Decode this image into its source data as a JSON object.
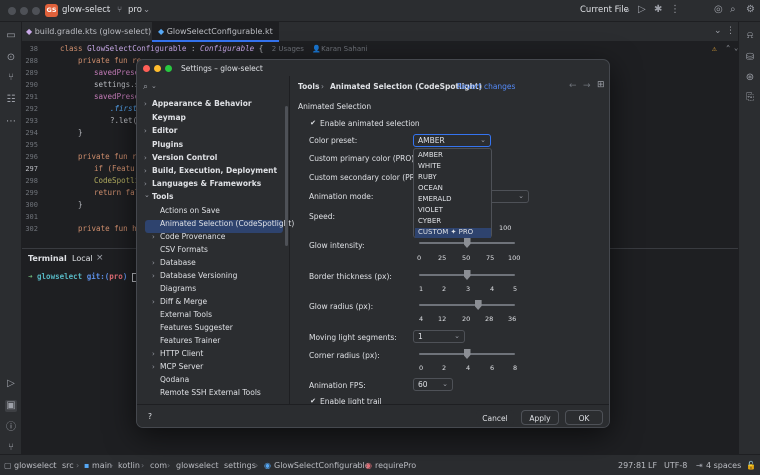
{
  "topbar": {
    "project_badge": "GS",
    "project_name": "glow-select",
    "branch": "pro",
    "run_config": "Current File"
  },
  "tabs": [
    {
      "label": "build.gradle.kts (glow-select)"
    },
    {
      "label": "GlowSelectConfigurable.kt"
    }
  ],
  "editor": {
    "line_numbers": [
      "38",
      "288",
      "289",
      "290",
      "291",
      "292",
      "293",
      "294",
      "295",
      "296",
      "297",
      "298",
      "299",
      "300",
      "301",
      "302",
      "303"
    ],
    "class_line": {
      "kw": "class",
      "name": "GlowSelectConfigurable",
      "colon": ":",
      "super": "Configurable",
      "brace": "{",
      "usages": "2 Usages",
      "author": "Karan Sahani"
    },
    "lines": [
      "private fun re",
      "savedPrese",
      "settings.s",
      "savedPrese",
      ".first",
      "?.let(",
      "}",
      "private fun re",
      "if (Featu",
      "CodeSpotli",
      "return fals",
      "}",
      "private fun ha"
    ]
  },
  "terminal": {
    "tab_terminal": "Terminal",
    "tab_local": "Local",
    "prompt_dir": "glowselect",
    "prompt_git": "git:(",
    "prompt_branch": "pro",
    "prompt_end": ")"
  },
  "dialog": {
    "title": "Settings – glow-select",
    "search_placeholder": "",
    "breadcrumb_parent": "Tools",
    "breadcrumb_sep": "›",
    "breadcrumb_current": "Animated Selection (CodeSpotlight)",
    "revert": "Revert changes",
    "tree": [
      {
        "label": "Appearance & Behavior",
        "arrow": "›",
        "bold": true
      },
      {
        "label": "Keymap",
        "arrow": "",
        "bold": true
      },
      {
        "label": "Editor",
        "arrow": "›",
        "bold": true
      },
      {
        "label": "Plugins",
        "arrow": "",
        "bold": true
      },
      {
        "label": "Version Control",
        "arrow": "›",
        "bold": true
      },
      {
        "label": "Build, Execution, Deployment",
        "arrow": "›",
        "bold": true
      },
      {
        "label": "Languages & Frameworks",
        "arrow": "›",
        "bold": true
      },
      {
        "label": "Tools",
        "arrow": "⌄",
        "bold": true
      },
      {
        "label": "Actions on Save",
        "arrow": "",
        "bold": false
      },
      {
        "label": "Animated Selection (CodeSpotlight)",
        "arrow": "",
        "bold": false,
        "selected": true
      },
      {
        "label": "Code Provenance",
        "arrow": "›",
        "bold": false
      },
      {
        "label": "CSV Formats",
        "arrow": "",
        "bold": false
      },
      {
        "label": "Database",
        "arrow": "›",
        "bold": false
      },
      {
        "label": "Database Versioning",
        "arrow": "›",
        "bold": false
      },
      {
        "label": "Diagrams",
        "arrow": "",
        "bold": false
      },
      {
        "label": "Diff & Merge",
        "arrow": "›",
        "bold": false
      },
      {
        "label": "External Tools",
        "arrow": "",
        "bold": false
      },
      {
        "label": "Features Suggester",
        "arrow": "",
        "bold": false
      },
      {
        "label": "Features Trainer",
        "arrow": "",
        "bold": false
      },
      {
        "label": "HTTP Client",
        "arrow": "›",
        "bold": false
      },
      {
        "label": "MCP Server",
        "arrow": "›",
        "bold": false
      },
      {
        "label": "Qodana",
        "arrow": "",
        "bold": false
      },
      {
        "label": "Remote SSH External Tools",
        "arrow": "",
        "bold": false
      }
    ],
    "section_title": "Animated Selection",
    "enable_label": "Enable animated selection",
    "enable_checked": true,
    "color_preset_label": "Color preset:",
    "color_preset_value": "AMBER",
    "preset_options": [
      "AMBER",
      "WHITE",
      "RUBY",
      "OCEAN",
      "EMERALD",
      "VIOLET",
      "CYBER",
      "CUSTOM ✦ PRO"
    ],
    "primary_color_label": "Custom primary color (PRO):",
    "secondary_color_label": "Custom secondary color (PRO):",
    "animation_mode_label": "Animation mode:",
    "speed_label": "Speed:",
    "speed_ticks": [
      "0",
      "25",
      "50",
      "75",
      "100"
    ],
    "glow_intensity_label": "Glow intensity:",
    "glow_intensity_ticks": [
      "0",
      "25",
      "50",
      "75",
      "100"
    ],
    "glow_intensity_value": 50,
    "border_label": "Border thickness (px):",
    "border_ticks": [
      "1",
      "2",
      "3",
      "4",
      "5"
    ],
    "border_value": 3,
    "glow_radius_label": "Glow radius (px):",
    "glow_radius_ticks": [
      "4",
      "12",
      "20",
      "28",
      "36"
    ],
    "glow_radius_value": 24,
    "segments_label": "Moving light segments:",
    "segments_value": "1",
    "corner_label": "Corner radius (px):",
    "corner_ticks": [
      "0",
      "2",
      "4",
      "6",
      "8"
    ],
    "corner_value": 4,
    "fps_label": "Animation FPS:",
    "fps_value": "60",
    "trail_label": "Enable light trail",
    "trail_checked": true,
    "help": "?",
    "cancel": "Cancel",
    "apply": "Apply",
    "ok": "OK"
  },
  "statusbar": {
    "path": [
      "glowselect",
      "src",
      "main",
      "kotlin",
      "com",
      "glowselect",
      "settings",
      "GlowSelectConfigurable",
      "requirePro"
    ],
    "position": "297:81",
    "line_sep": "LF",
    "encoding": "UTF-8",
    "indent": "4 spaces"
  },
  "colors": {
    "accent": "#3574f0",
    "selection": "#2e436e",
    "badge": "#e0613b"
  }
}
